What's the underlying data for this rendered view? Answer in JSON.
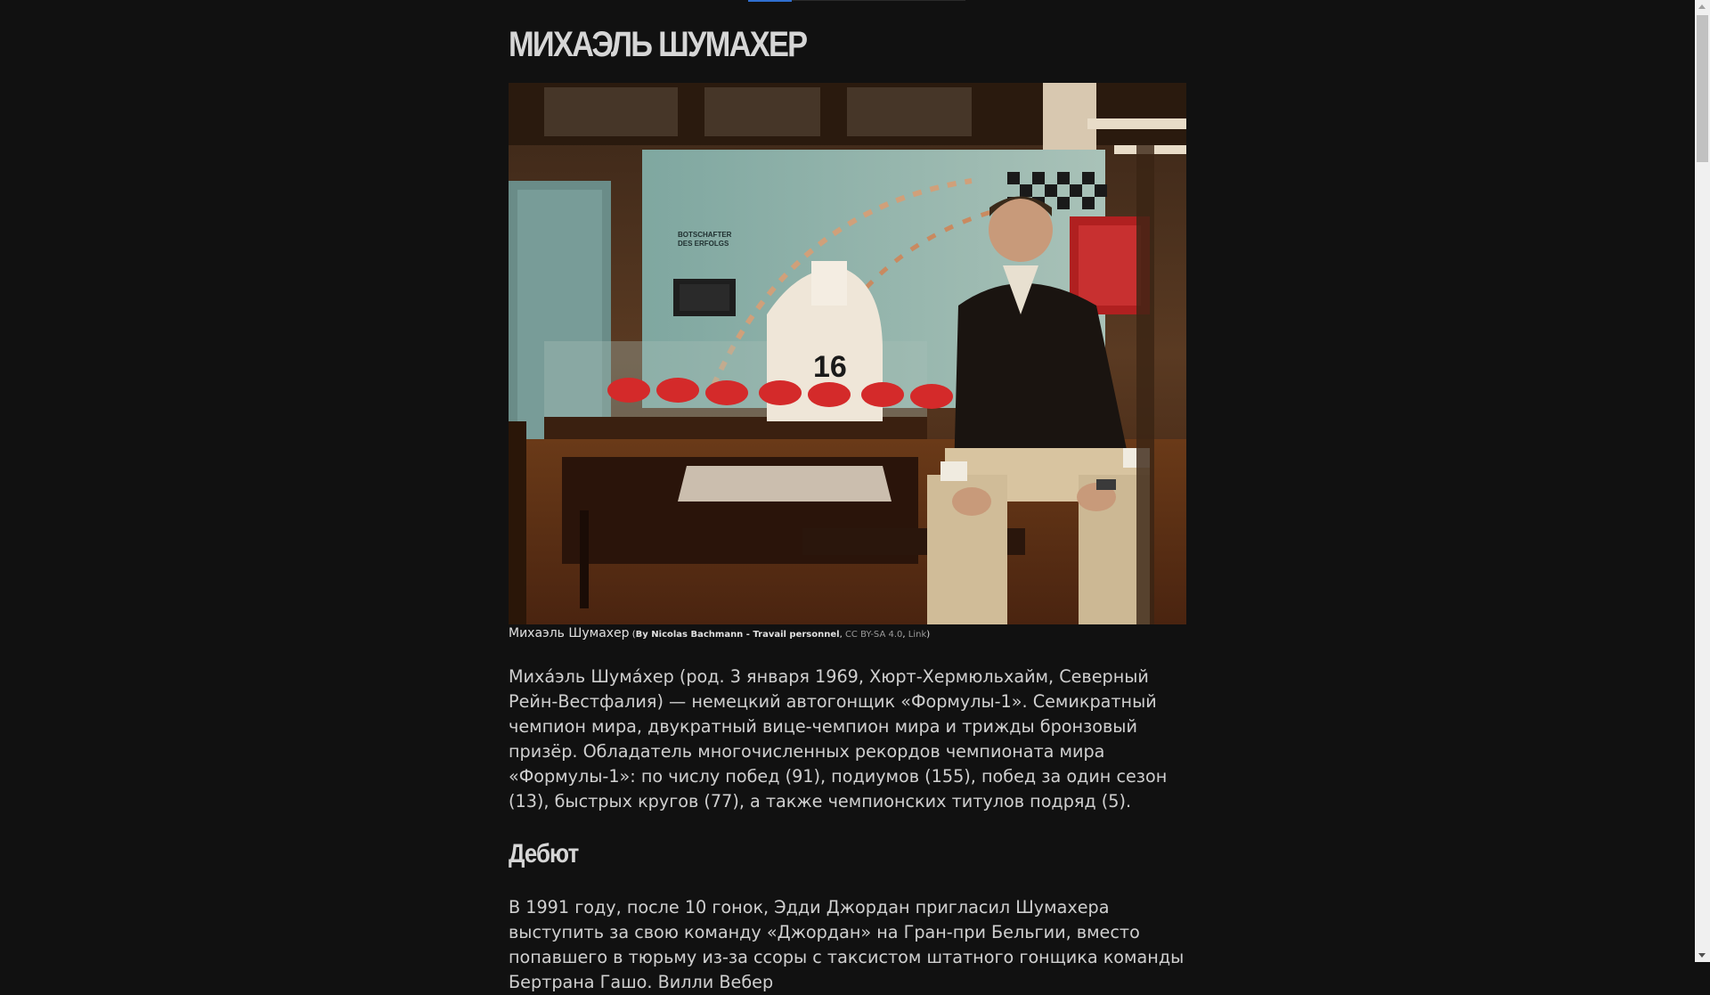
{
  "article": {
    "title": "МИХАЭЛЬ ШУМАХЕР",
    "image_alt": "Михаэль Шумахер",
    "caption": {
      "name": "Михаэль Шумахер",
      "open_paren": " (",
      "author": "By Nicolas Bachmann - Travail personnel",
      "sep1": ", ",
      "license": "CC BY-SA 4.0",
      "sep2": ", ",
      "link": "Link",
      "close_paren": ")"
    },
    "intro": "Миха́эль Шума́хер (род. 3 января 1969, Хюрт-Хермюльхайм, Северный Рейн-Вестфалия) — немецкий автогонщик «Формулы-1». Семикратный чемпион мира, двукратный вице-чемпион мира и трижды бронзовый призёр. Обладатель многочисленных рекордов чемпионата мира «Формулы-1»: по числу побед (91), подиумов (155), побед за один сезон (13), быстрых кругов (77), а также чемпионских титулов подряд (5).",
    "sections": [
      {
        "heading": "Дебют",
        "text": "В 1991 году, после 10 гонок, Эдди Джордан пригласил Шумахера выступить за свою команду «Джордан» на Гран-при Бельгии, вместо попавшего в тюрьму из-за ссоры с таксистом штатного гонщика команды Бертрана Гашо. Вилли Вебер"
      }
    ]
  },
  "photo_signs": {
    "botschafter": "BOTSCHAFTER",
    "erfolgs": "DES ERFOLGS",
    "car_number": "16"
  }
}
